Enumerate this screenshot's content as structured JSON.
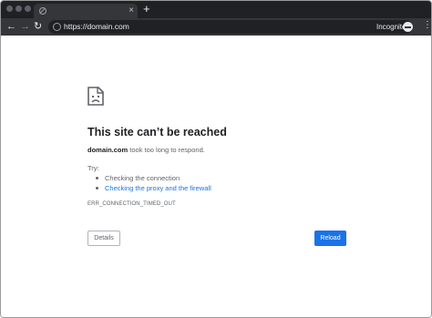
{
  "browser": {
    "url": "https://domain.com",
    "incognito_label": "Incognito",
    "new_tab_label": "+",
    "tab_close": "×",
    "menu_glyph": "⋮",
    "back_glyph": "←",
    "forward_glyph": "→",
    "reload_glyph": "↻"
  },
  "error": {
    "title": "This site can’t be reached",
    "domain": "domain.com",
    "description_suffix": " took too long to respond.",
    "try_label": "Try:",
    "suggestions": [
      {
        "text": "Checking the connection",
        "link": false
      },
      {
        "text": "Checking the proxy and the firewall",
        "link": true
      }
    ],
    "code": "ERR_CONNECTION_TIMED_OUT",
    "details_button": "Details",
    "reload_button": "Reload"
  },
  "colors": {
    "accent": "#1a73e8",
    "text_secondary": "#5f6368"
  }
}
